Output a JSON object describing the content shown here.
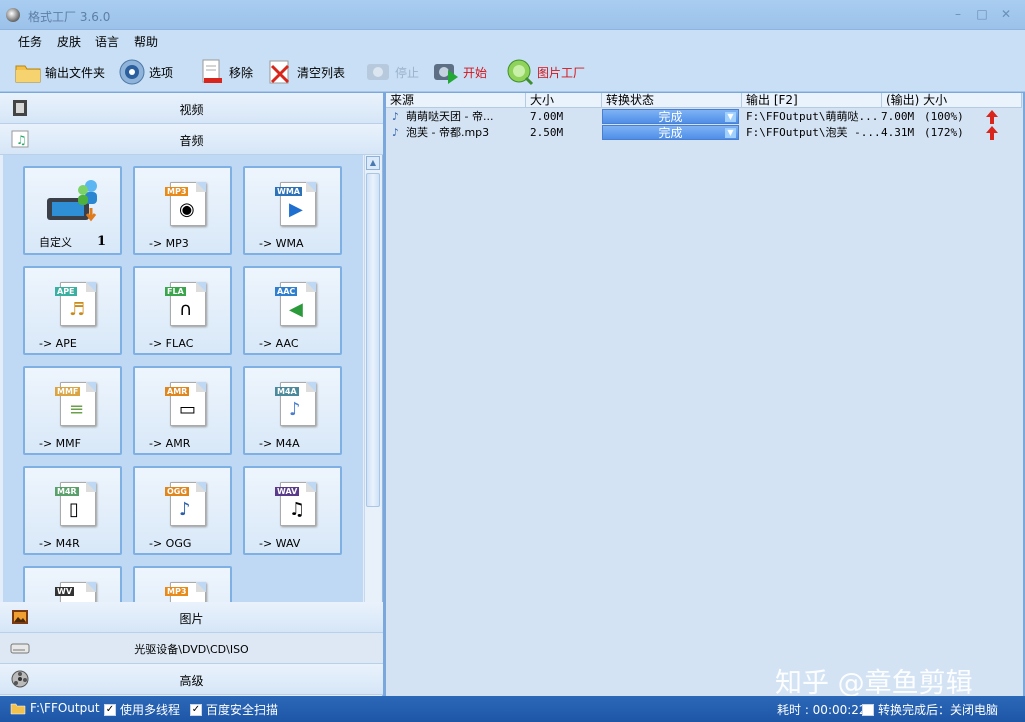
{
  "window": {
    "title": "格式工厂 3.6.0"
  },
  "menu": [
    "任务",
    "皮肤",
    "语言",
    "帮助"
  ],
  "toolbar": {
    "output_folder": "输出文件夹",
    "options": "选项",
    "remove": "移除",
    "clear_list": "清空列表",
    "stop": "停止",
    "start": "开始",
    "picture_factory": "图片工厂"
  },
  "sidebar": {
    "video": "视频",
    "audio": "音频",
    "picture": "图片",
    "rom": "光驱设备\\DVD\\CD\\ISO",
    "advanced": "高级"
  },
  "formats": [
    {
      "label": "自定义",
      "badge": "1",
      "tag": ""
    },
    {
      "label": "-> MP3",
      "tag": "MP3"
    },
    {
      "label": "-> WMA",
      "tag": "WMA"
    },
    {
      "label": "-> APE",
      "tag": "APE"
    },
    {
      "label": "-> FLAC",
      "tag": "FLA"
    },
    {
      "label": "-> AAC",
      "tag": "AAC"
    },
    {
      "label": "-> MMF",
      "tag": "MMF"
    },
    {
      "label": "-> AMR",
      "tag": "AMR"
    },
    {
      "label": "-> M4A",
      "tag": "M4A"
    },
    {
      "label": "-> M4R",
      "tag": "M4R"
    },
    {
      "label": "-> OGG",
      "tag": "OGG"
    },
    {
      "label": "-> WAV",
      "tag": "WAV"
    },
    {
      "label": "",
      "tag": "WV"
    },
    {
      "label": "",
      "tag": "MP3"
    }
  ],
  "table": {
    "headers": [
      "来源",
      "大小",
      "转换状态",
      "输出 [F2]",
      "(输出) 大小"
    ],
    "rows": [
      {
        "source": "萌萌哒天团 - 帝...",
        "size": "7.00M",
        "status": "完成",
        "output": "F:\\FFOutput\\萌萌哒...",
        "out_size": "7.00M",
        "ratio": "(100%)"
      },
      {
        "source": "泡芙 - 帝都.mp3",
        "size": "2.50M",
        "status": "完成",
        "output": "F:\\FFOutput\\泡芙 -...",
        "out_size": "4.31M",
        "ratio": "(172%)"
      }
    ]
  },
  "watermark": "知乎 @章鱼剪辑",
  "statusbar": {
    "output_path": "F:\\FFOutput",
    "multithread": "使用多线程",
    "baidu_scan": "百度安全扫描",
    "elapsed": "耗时 : 00:00:22",
    "shutdown": "转换完成后：关闭电脑"
  }
}
